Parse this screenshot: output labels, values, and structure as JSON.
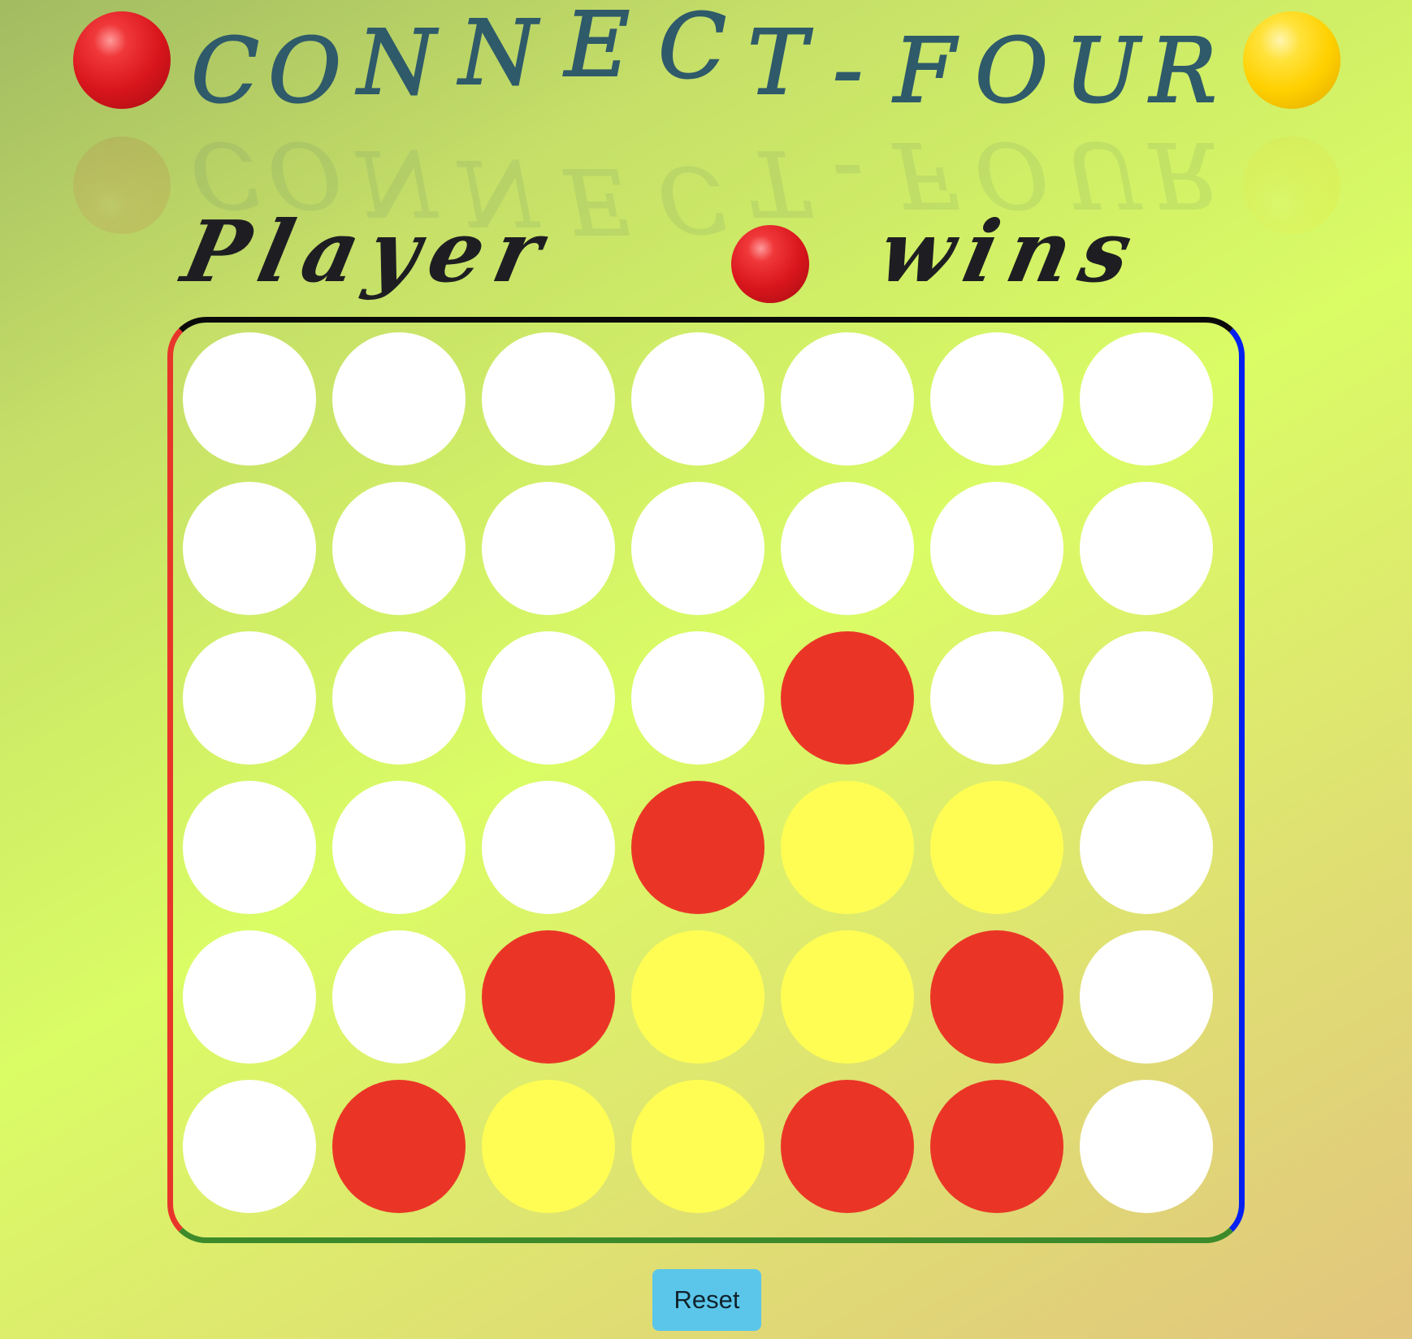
{
  "title": {
    "letters": [
      "C",
      "O",
      "N",
      "N",
      "E",
      "C",
      "T",
      "-",
      "F",
      "O",
      "U",
      "R"
    ],
    "left_orb_icon": "red-disc-icon",
    "right_orb_icon": "yellow-disc-icon"
  },
  "status": {
    "prefix": "Player",
    "player_icon": "red-disc-icon",
    "suffix": "wins"
  },
  "board": {
    "columns": 7,
    "rows": 6,
    "cells": [
      [
        "empty",
        "empty",
        "empty",
        "empty",
        "empty",
        "empty",
        "empty"
      ],
      [
        "empty",
        "empty",
        "empty",
        "empty",
        "empty",
        "empty",
        "empty"
      ],
      [
        "empty",
        "empty",
        "empty",
        "empty",
        "red",
        "empty",
        "empty"
      ],
      [
        "empty",
        "empty",
        "empty",
        "red",
        "yellow",
        "yellow",
        "empty"
      ],
      [
        "empty",
        "empty",
        "red",
        "yellow",
        "yellow",
        "red",
        "empty"
      ],
      [
        "empty",
        "red",
        "yellow",
        "yellow",
        "red",
        "red",
        "empty"
      ]
    ],
    "colors": {
      "empty": "#ffffff",
      "red": "#ea3526",
      "yellow": "#fffd54",
      "border_top": "#0a0a0a",
      "border_left": "#e8352a",
      "border_right": "#0420f0",
      "border_bottom": "#3d8a2a"
    }
  },
  "controls": {
    "reset_label": "Reset",
    "reset_color": "#5bc6ea"
  }
}
